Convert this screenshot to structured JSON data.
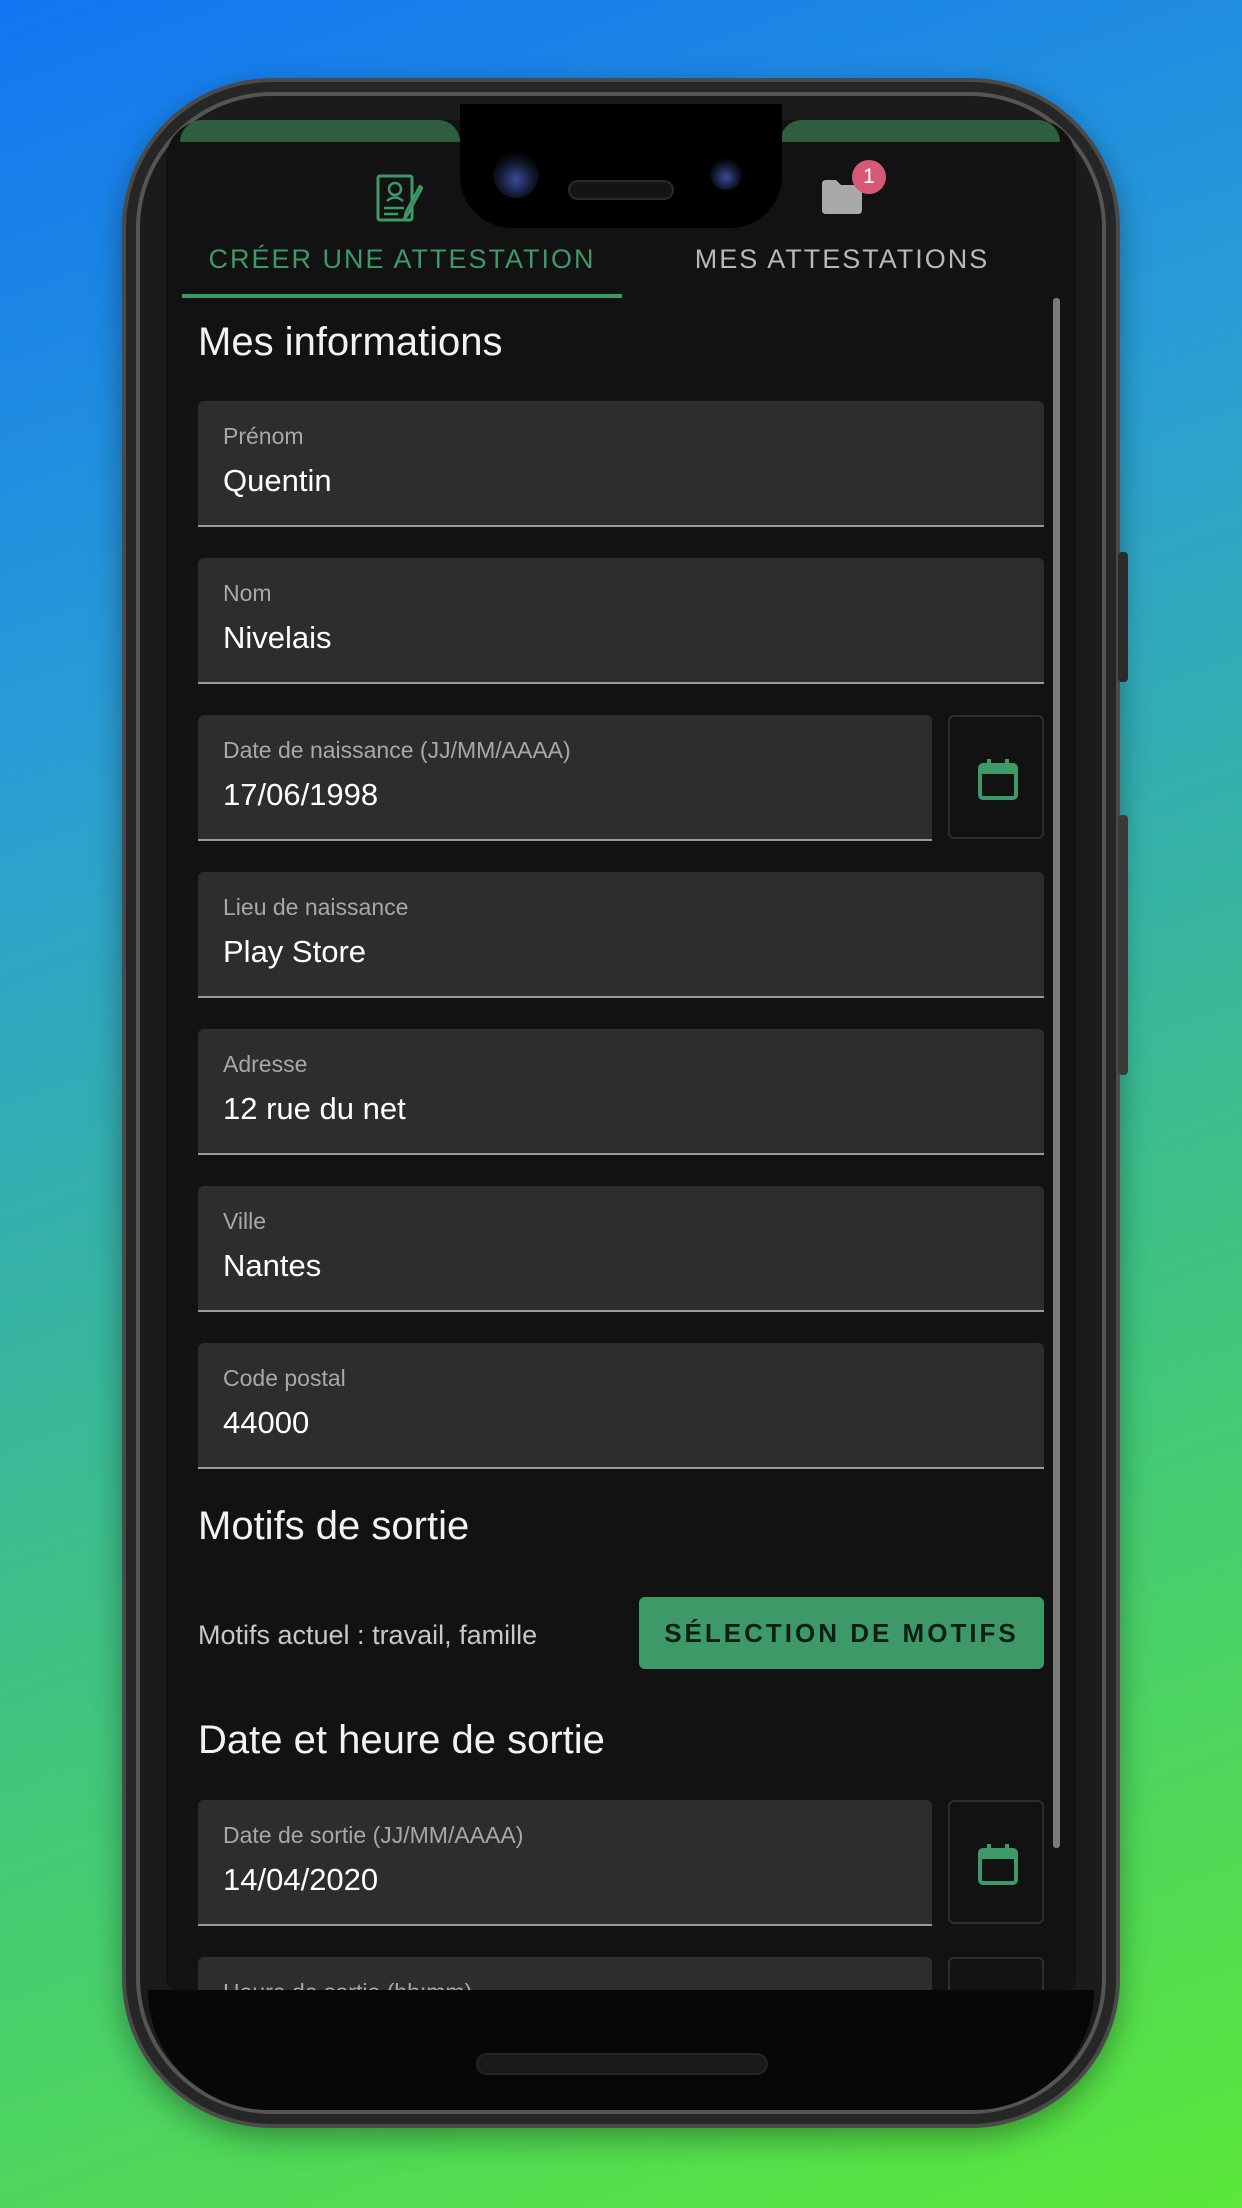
{
  "tabs": [
    {
      "label": "CRÉER UNE ATTESTATION",
      "icon": "certificate-pen-icon",
      "active": true
    },
    {
      "label": "MES ATTESTATIONS",
      "icon": "folder-icon",
      "badge": "1"
    }
  ],
  "sections": {
    "info_title": "Mes informations",
    "motifs_title": "Motifs de sortie",
    "datetime_title": "Date et heure de sortie"
  },
  "fields": {
    "prenom": {
      "label": "Prénom",
      "value": "Quentin"
    },
    "nom": {
      "label": "Nom",
      "value": "Nivelais"
    },
    "naissance": {
      "label": "Date de naissance (JJ/MM/AAAA)",
      "value": "17/06/1998"
    },
    "lieu": {
      "label": "Lieu de naissance",
      "value": "Play Store"
    },
    "adresse": {
      "label": "Adresse",
      "value": "12 rue du net"
    },
    "ville": {
      "label": "Ville",
      "value": "Nantes"
    },
    "code_postal": {
      "label": "Code postal",
      "value": "44000"
    },
    "date_sortie": {
      "label": "Date de sortie (JJ/MM/AAAA)",
      "value": "14/04/2020"
    },
    "heure_sortie": {
      "label": "Heure de sortie (hh:mm)",
      "value": ""
    }
  },
  "motifs": {
    "current": "Motifs actuel : travail, famille",
    "button_label": "SÉLECTION DE MOTIFS"
  },
  "colors": {
    "accent": "#3d9a68",
    "background": "#121212",
    "field_bg": "#2d2d2d",
    "badge": "#d65a78"
  }
}
